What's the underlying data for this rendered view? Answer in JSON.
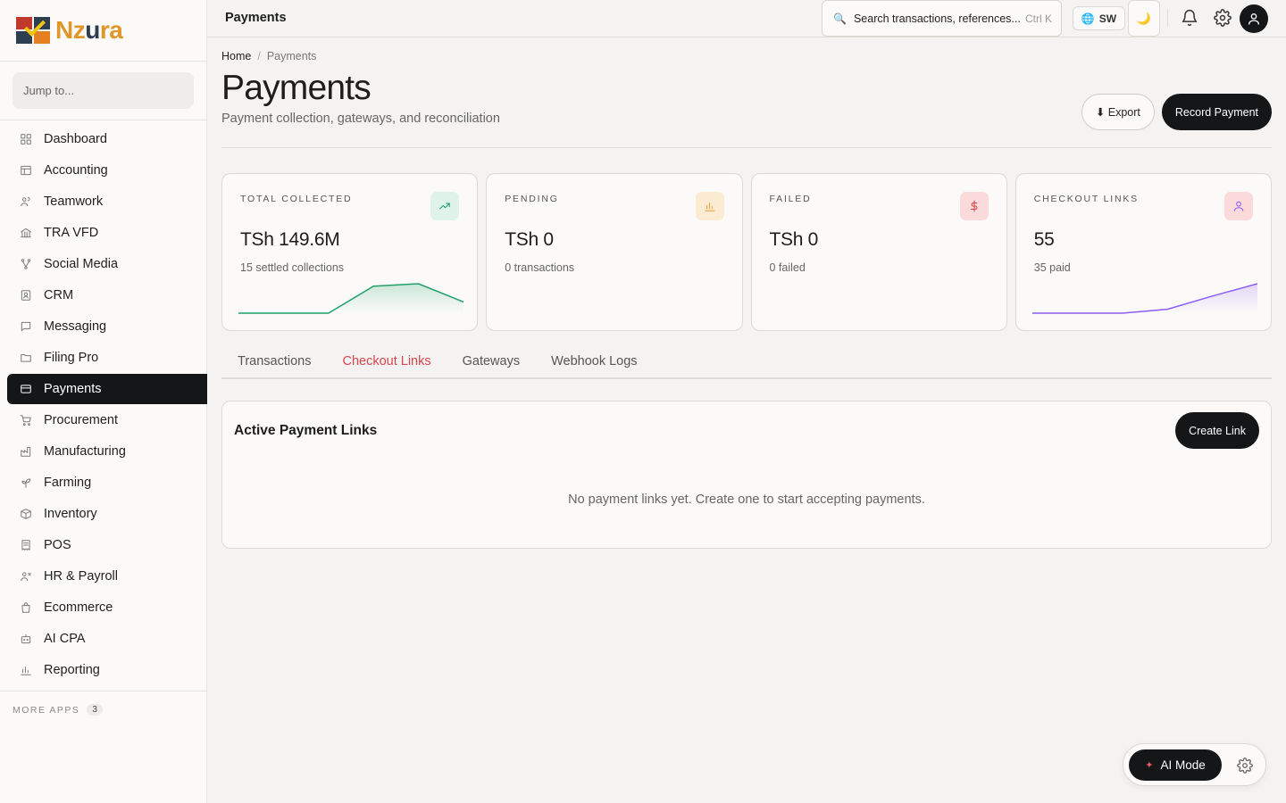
{
  "brand": {
    "logo_text_1": "Nz",
    "logo_text_2": "u",
    "logo_text_3": "ra"
  },
  "sidebar": {
    "jump_placeholder": "Jump to...",
    "items": [
      {
        "label": "Dashboard",
        "icon": "grid-icon"
      },
      {
        "label": "Accounting",
        "icon": "ledger-icon"
      },
      {
        "label": "Teamwork",
        "icon": "users-icon"
      },
      {
        "label": "TRA VFD",
        "icon": "bank-icon"
      },
      {
        "label": "Social Media",
        "icon": "share-icon"
      },
      {
        "label": "CRM",
        "icon": "contact-icon"
      },
      {
        "label": "Messaging",
        "icon": "message-icon"
      },
      {
        "label": "Filing Pro",
        "icon": "folder-icon"
      },
      {
        "label": "Payments",
        "icon": "card-icon",
        "active": true
      },
      {
        "label": "Procurement",
        "icon": "cart-icon"
      },
      {
        "label": "Manufacturing",
        "icon": "factory-icon"
      },
      {
        "label": "Farming",
        "icon": "sprout-icon"
      },
      {
        "label": "Inventory",
        "icon": "box-icon"
      },
      {
        "label": "POS",
        "icon": "receipt-icon"
      },
      {
        "label": "HR & Payroll",
        "icon": "user-x-icon"
      },
      {
        "label": "Ecommerce",
        "icon": "bag-icon"
      },
      {
        "label": "AI CPA",
        "icon": "bot-icon"
      },
      {
        "label": "Reporting",
        "icon": "bar-chart-icon"
      }
    ],
    "more_apps_label": "MORE APPS",
    "more_apps_count": "3"
  },
  "topbar": {
    "title": "Payments",
    "search_placeholder": "Search transactions, references...",
    "search_shortcut": "Ctrl K",
    "language": "SW"
  },
  "page": {
    "breadcrumb_home": "Home",
    "breadcrumb_sep": "/",
    "breadcrumb_current": "Payments",
    "title": "Payments",
    "subtitle": "Payment collection, gateways, and reconciliation",
    "export_label": "⬇ Export",
    "record_label": "Record Payment"
  },
  "cards": [
    {
      "label": "TOTAL COLLECTED",
      "value": "TSh 149.6M",
      "sub": "15 settled collections",
      "icon": "trend-up-icon",
      "color": "#22a06b",
      "bg": "#dff3e8",
      "spark": [
        0,
        0,
        0,
        0.55,
        0.6,
        0.23
      ]
    },
    {
      "label": "PENDING",
      "value": "TSh 0",
      "sub": "0 transactions",
      "icon": "bar-chart-icon",
      "color": "#e3a23a",
      "bg": "#fbebd2",
      "spark": null
    },
    {
      "label": "FAILED",
      "value": "TSh 0",
      "sub": "0 failed",
      "icon": "dollar-icon",
      "color": "#d9434b",
      "bg": "#fadada",
      "spark": null
    },
    {
      "label": "CHECKOUT LINKS",
      "value": "55",
      "sub": "35 paid",
      "icon": "user-icon",
      "color": "#8b5cf6",
      "bg": "#fadada",
      "spark": [
        0,
        0,
        0,
        0.08,
        0.35,
        0.6
      ]
    }
  ],
  "tabs": [
    {
      "label": "Transactions",
      "active": false
    },
    {
      "label": "Checkout Links",
      "active": true
    },
    {
      "label": "Gateways",
      "active": false
    },
    {
      "label": "Webhook Logs",
      "active": false
    }
  ],
  "panel": {
    "title": "Active Payment Links",
    "create_label": "Create Link",
    "empty_text": "No payment links yet. Create one to start accepting payments."
  },
  "ai": {
    "label": "AI Mode"
  }
}
